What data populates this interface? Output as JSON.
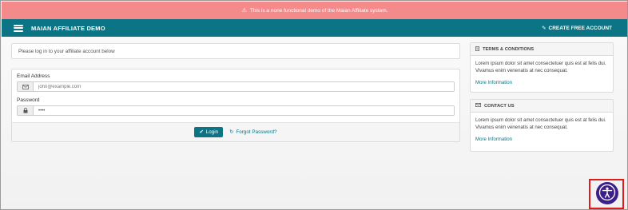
{
  "banner": {
    "text": "This is a none functional demo of the Maian Affiliate system."
  },
  "navbar": {
    "brand": "MAIAN AFFILIATE DEMO",
    "create_account": "CREATE FREE ACCOUNT"
  },
  "login": {
    "intro": "Please log in to your affiliate account below",
    "email_label": "Email Address",
    "email_placeholder": "john@example.com",
    "password_label": "Password",
    "password_value": "••••",
    "login_button": "Login",
    "forgot_link": "Forgot Password?"
  },
  "terms": {
    "title": "TERMS & CONDITIONS",
    "body": "Lorem ipsum dolor sit amet consectetuer quis est at felis dui. Vivamus enim venenatis at nec consequat.",
    "link": "More Information"
  },
  "contact": {
    "title": "CONTACT US",
    "body": "Lorem ipsum dolor sit amet consectetuer quis est at felis dui. Vivamus enim venenatis at nec consequat.",
    "link": "More Information"
  },
  "icons": {
    "banner": "warning-icon",
    "menu": "hamburger-icon",
    "create": "pencil-icon",
    "email": "envelope-icon",
    "password": "lock-icon",
    "login": "check-icon",
    "forgot": "refresh-icon",
    "terms": "document-icon",
    "contact": "envelope-icon",
    "accessibility": "accessibility-icon"
  },
  "colors": {
    "banner": "#f48a8a",
    "primary": "#0b7585",
    "accessibility": "#3d1f8a",
    "highlight": "#e21a1a"
  }
}
